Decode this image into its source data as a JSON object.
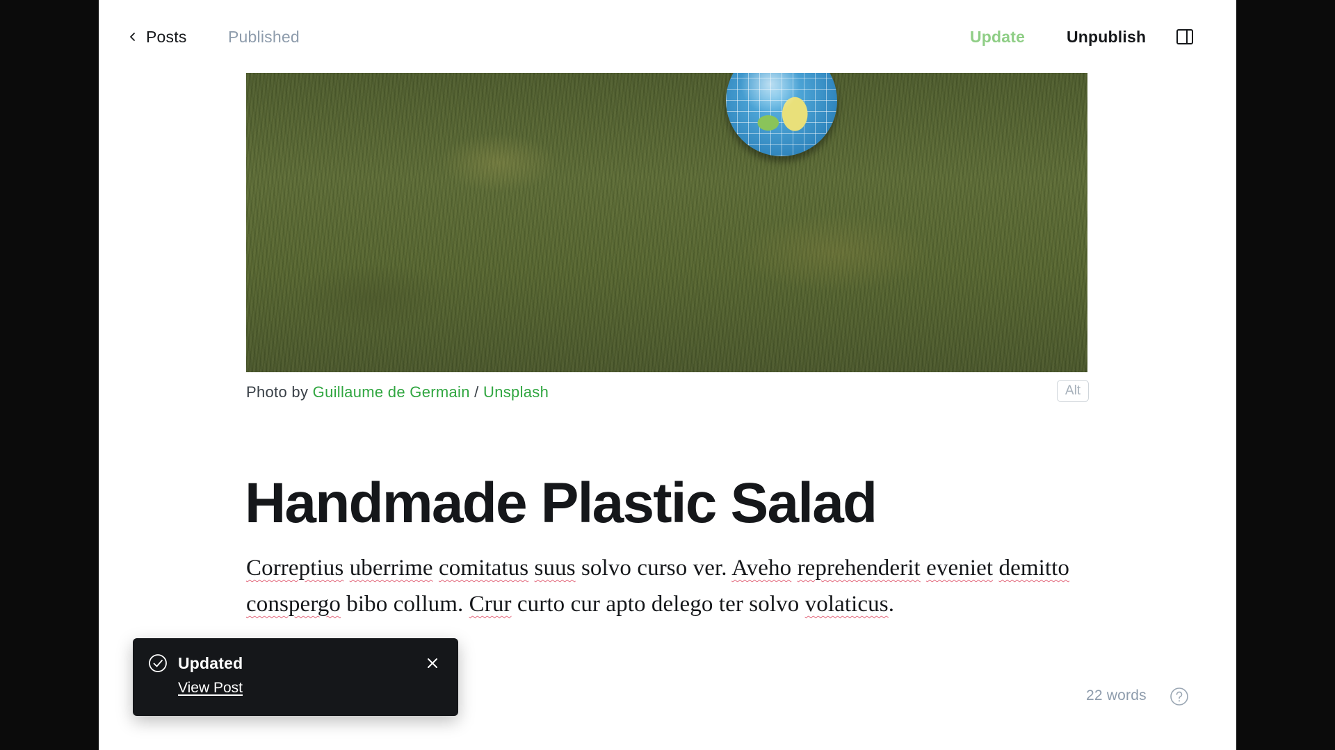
{
  "header": {
    "back_label": "Posts",
    "status": "Published",
    "update_label": "Update",
    "unpublish_label": "Unpublish",
    "colors": {
      "update": "#8fce86",
      "text": "#15171a",
      "muted": "#8e9cac"
    }
  },
  "feature_image": {
    "caption_prefix": "Photo by ",
    "author": "Guillaume de Germain",
    "separator": " / ",
    "source": "Unsplash",
    "alt_label": "Alt",
    "link_color": "#30a640"
  },
  "post": {
    "title": "Handmade Plastic Salad",
    "body_segments": [
      {
        "text": "Correptius",
        "misspelled": true
      },
      {
        "text": " ",
        "misspelled": false
      },
      {
        "text": "uberrime",
        "misspelled": true
      },
      {
        "text": " ",
        "misspelled": false
      },
      {
        "text": "comitatus",
        "misspelled": true
      },
      {
        "text": " ",
        "misspelled": false
      },
      {
        "text": "suus",
        "misspelled": true
      },
      {
        "text": " solvo curso ver. ",
        "misspelled": false
      },
      {
        "text": "Aveho",
        "misspelled": true
      },
      {
        "text": " ",
        "misspelled": false
      },
      {
        "text": "reprehenderit",
        "misspelled": true
      },
      {
        "text": " ",
        "misspelled": false
      },
      {
        "text": "eveniet",
        "misspelled": true
      },
      {
        "text": " ",
        "misspelled": false
      },
      {
        "text": "demitto",
        "misspelled": true
      },
      {
        "text": " ",
        "misspelled": false
      },
      {
        "text": "conspergo",
        "misspelled": true
      },
      {
        "text": " bibo collum. ",
        "misspelled": false
      },
      {
        "text": "Crur",
        "misspelled": true
      },
      {
        "text": " curto cur apto delego ter solvo ",
        "misspelled": false
      },
      {
        "text": "volaticus",
        "misspelled": true
      },
      {
        "text": ".",
        "misspelled": false
      }
    ]
  },
  "footer": {
    "word_count": "22 words",
    "help_icon": "question-circle-icon"
  },
  "toast": {
    "title": "Updated",
    "link_label": "View Post",
    "icon": "check-circle-icon",
    "close_icon": "close-icon"
  }
}
